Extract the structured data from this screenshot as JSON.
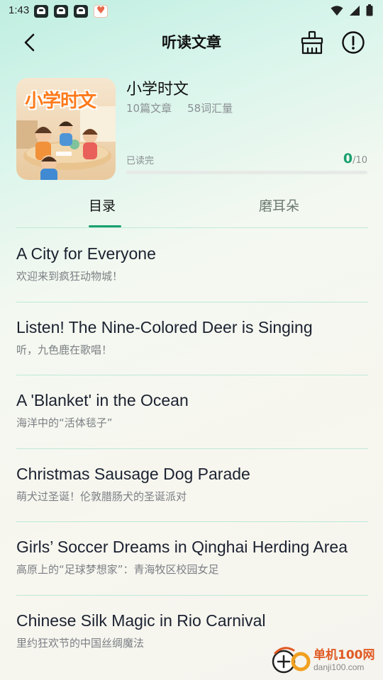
{
  "status_bar": {
    "time": "1:43"
  },
  "header": {
    "title": "听读文章"
  },
  "book": {
    "cover_title": "小学时文",
    "title": "小学时文",
    "article_count": "10篇文章",
    "vocab_count": "58词汇量",
    "progress_label": "已读完",
    "read": "0",
    "total": "/10",
    "progress_fraction": 0
  },
  "tabs": [
    {
      "label": "目录",
      "active": true
    },
    {
      "label": "磨耳朵",
      "active": false
    }
  ],
  "articles": [
    {
      "title": "A City for Everyone",
      "subtitle": "欢迎来到疯狂动物城！"
    },
    {
      "title": "Listen! The Nine-Colored Deer is Singing",
      "subtitle": "听，九色鹿在歌唱！"
    },
    {
      "title": "A 'Blanket' in the Ocean",
      "subtitle": "海洋中的“活体毯子”"
    },
    {
      "title": "Christmas Sausage Dog Parade",
      "subtitle": "萌犬过圣诞！伦敦腊肠犬的圣诞派对"
    },
    {
      "title": "Girls’ Soccer Dreams in Qinghai Herding Area",
      "subtitle": "高原上的“足球梦想家”：青海牧区校园女足"
    },
    {
      "title": "Chinese Silk Magic in Rio Carnival",
      "subtitle": "里约狂欢节的中国丝绸魔法"
    }
  ],
  "watermark": {
    "name": "单机100网",
    "domain": "danji100.com"
  },
  "colors": {
    "accent": "#1aa070",
    "divider": "#bfe9d8"
  }
}
